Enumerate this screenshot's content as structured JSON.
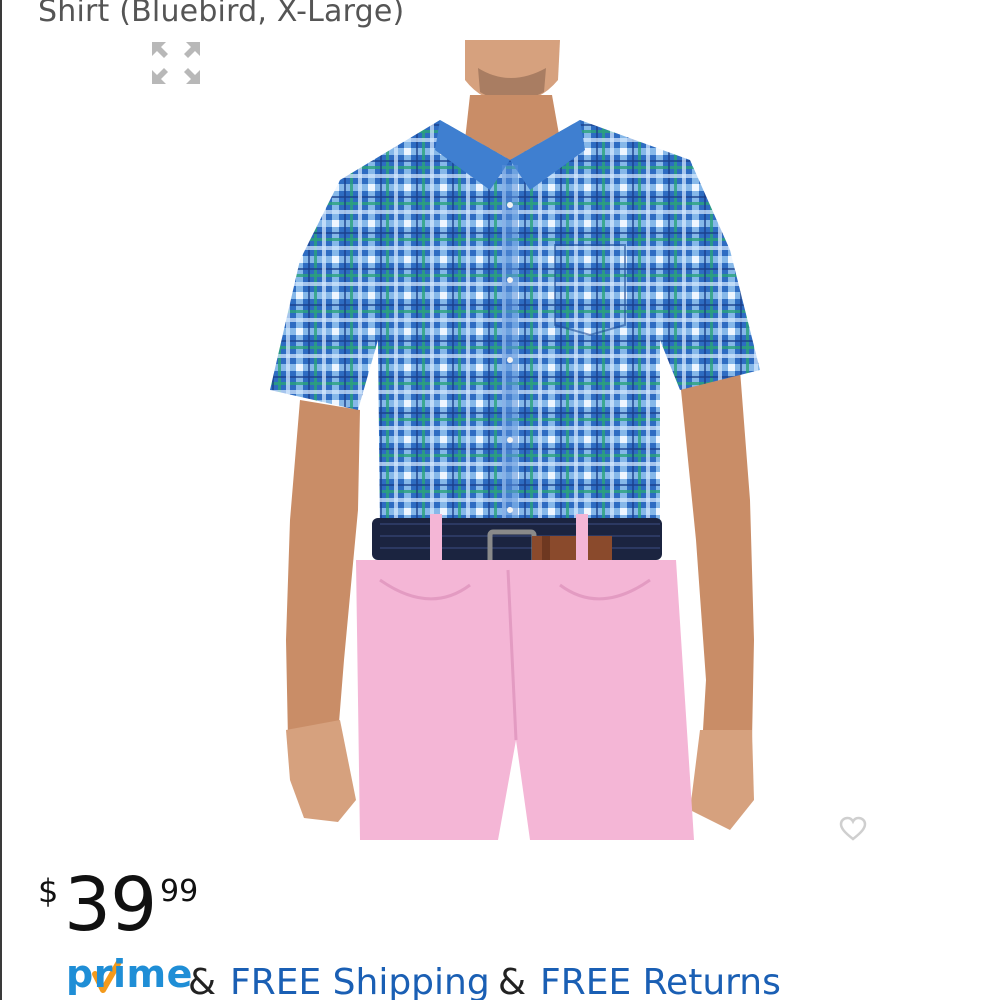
{
  "product": {
    "title_fragment": "Shirt (Bluebird, X-Large)",
    "image_alt": "Man wearing blue plaid short-sleeve button-down shirt with pink pants and navy belt"
  },
  "icons": {
    "expand": "expand-arrows-icon",
    "wishlist": "heart-outline-icon",
    "prime_check": "prime-check-icon"
  },
  "price": {
    "currency": "$",
    "whole": "39",
    "fraction": "99"
  },
  "shipping": {
    "prime_label": "prime",
    "amp1": "&",
    "free_shipping": "FREE Shipping",
    "amp2": "&",
    "free_returns": "FREE Returns"
  },
  "colors": {
    "prime_blue": "#1f8ed6",
    "prime_check_orange": "#f39a1c",
    "link_blue": "#1a5fb4",
    "price_text": "#111111",
    "title_gray": "#555555",
    "shirt_blue": "#2f6fc4",
    "pants_pink": "#f4b6d6",
    "belt_navy": "#1b2440"
  }
}
